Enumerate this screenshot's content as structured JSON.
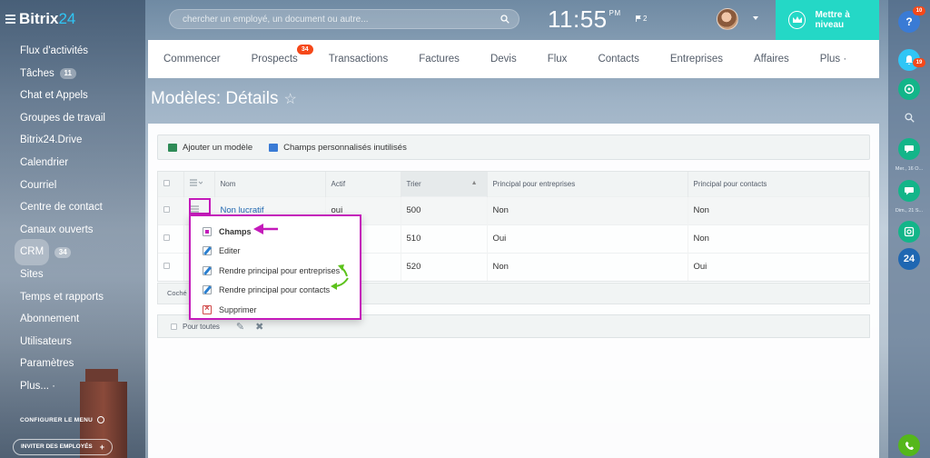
{
  "sidebar": {
    "brand": "Bitrix",
    "brand_suffix": "24",
    "items": [
      {
        "label": "Flux d'activités",
        "counter": ""
      },
      {
        "label": "Tâches",
        "counter": "11"
      },
      {
        "label": "Chat et Appels",
        "counter": ""
      },
      {
        "label": "Groupes de travail",
        "counter": ""
      },
      {
        "label": "Bitrix24.Drive",
        "counter": ""
      },
      {
        "label": "Calendrier",
        "counter": ""
      },
      {
        "label": "Courriel",
        "counter": ""
      },
      {
        "label": "Centre de contact",
        "counter": ""
      },
      {
        "label": "Canaux ouverts",
        "counter": ""
      },
      {
        "label": "CRM",
        "counter": "34",
        "active": true
      },
      {
        "label": "Sites",
        "counter": ""
      },
      {
        "label": "Temps et rapports",
        "counter": ""
      },
      {
        "label": "Abonnement",
        "counter": ""
      },
      {
        "label": "Utilisateurs",
        "counter": ""
      },
      {
        "label": "Paramètres",
        "counter": ""
      },
      {
        "label": "Plus... ·",
        "counter": ""
      }
    ],
    "configure_label": "CONFIGURER LE MENU",
    "invite_label": "INVITER DES EMPLOYÉS",
    "invite_plus": "+"
  },
  "header": {
    "search_placeholder": "chercher un employé, un document ou autre...",
    "clock": "11:55",
    "clock_ampm": "PM",
    "flag_count": "2",
    "upgrade_label": "Mettre à niveau"
  },
  "nav": {
    "tabs": [
      {
        "label": "Commencer",
        "badge": ""
      },
      {
        "label": "Prospects",
        "badge": "34"
      },
      {
        "label": "Transactions",
        "badge": ""
      },
      {
        "label": "Factures",
        "badge": ""
      },
      {
        "label": "Devis",
        "badge": ""
      },
      {
        "label": "Flux",
        "badge": ""
      },
      {
        "label": "Contacts",
        "badge": ""
      },
      {
        "label": "Entreprises",
        "badge": ""
      },
      {
        "label": "Affaires",
        "badge": ""
      }
    ],
    "more_label": "Plus ·"
  },
  "page": {
    "title": "Modèles: Détails",
    "star": "☆"
  },
  "toolbar": {
    "add_label": "Ajouter un modèle",
    "unused_fields_label": "Champs personnalisés inutilisés"
  },
  "grid": {
    "columns": {
      "name": "Nom",
      "active": "Actif",
      "sort": "Trier",
      "main_company": "Principal pour entreprises",
      "main_contact": "Principal pour contacts"
    },
    "rows": [
      {
        "name": "Non lucratif",
        "active": "oui",
        "sort": "500",
        "main_company": "Non",
        "main_contact": "Non"
      },
      {
        "name": "",
        "active": "",
        "sort": "510",
        "main_company": "Oui",
        "main_contact": "Non"
      },
      {
        "name": "",
        "active": "",
        "sort": "520",
        "main_company": "Non",
        "main_contact": "Oui"
      }
    ],
    "checked_label": "Coché",
    "for_all_label": "Pour toutes"
  },
  "popup_menu": {
    "items": [
      {
        "label": "Champs",
        "icon": "fields-icon"
      },
      {
        "label": "Editer",
        "icon": "edit-icon"
      },
      {
        "label": "Rendre principal pour entreprises",
        "icon": "edit-icon"
      },
      {
        "label": "Rendre principal pour contacts",
        "icon": "edit-icon"
      },
      {
        "label": "Supprimer",
        "icon": "delete-icon"
      }
    ]
  },
  "right_rail": {
    "help_badge": "10",
    "notif_badge": "19",
    "label_1": "Mer., 16 O...",
    "label_2": "Dim., 21 S..."
  },
  "colors": {
    "accent_teal": "#24d8c6",
    "highlight_magenta": "#c41aba",
    "arrow_green": "#5cc21b",
    "badge_red": "#f54819",
    "link_blue": "#2067b0"
  }
}
